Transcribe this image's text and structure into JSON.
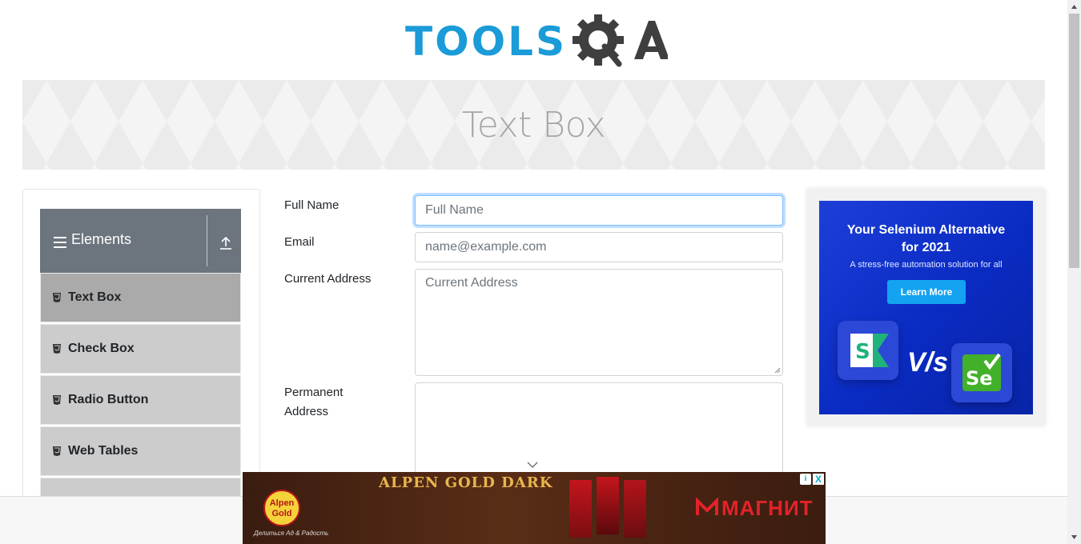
{
  "header": {
    "logo_text_left": "TOOLS",
    "logo_text_right": "QA"
  },
  "banner": {
    "title": "Text Box"
  },
  "sidebar": {
    "group_title": "Elements",
    "items": [
      {
        "label": "Text Box",
        "active": true
      },
      {
        "label": "Check Box",
        "active": false
      },
      {
        "label": "Radio Button",
        "active": false
      },
      {
        "label": "Web Tables",
        "active": false
      }
    ]
  },
  "form": {
    "full_name": {
      "label": "Full Name",
      "placeholder": "Full Name"
    },
    "email": {
      "label": "Email",
      "placeholder": "name@example.com"
    },
    "current_address": {
      "label": "Current Address",
      "placeholder": "Current Address"
    },
    "permanent_address": {
      "label_line1": "Permanent",
      "label_line2": "Address",
      "placeholder": ""
    }
  },
  "side_ad": {
    "headline_line1": "Your Selenium Alternative",
    "headline_line2": "for 2021",
    "subtext": "A stress-free automation solution for all",
    "cta": "Learn More",
    "vs_text": "V/s",
    "left_tile_letter": "S",
    "right_tile_letter": "Se"
  },
  "bottom_ad": {
    "logo_text": "Alpen Gold",
    "tagline": "Делиться Ад & Радость",
    "headline": "ALPEN GOLD DARK",
    "retailer": "МАГНИТ",
    "choices_icon": "i",
    "close_icon": "X"
  },
  "colors": {
    "brand_blue": "#1b9bd7",
    "group_header": "#6c757d",
    "menu_item": "#cccccc",
    "menu_item_active": "#aaaaaa",
    "ad_blue": "#1d3fd8",
    "magnit_red": "#e3222a"
  }
}
